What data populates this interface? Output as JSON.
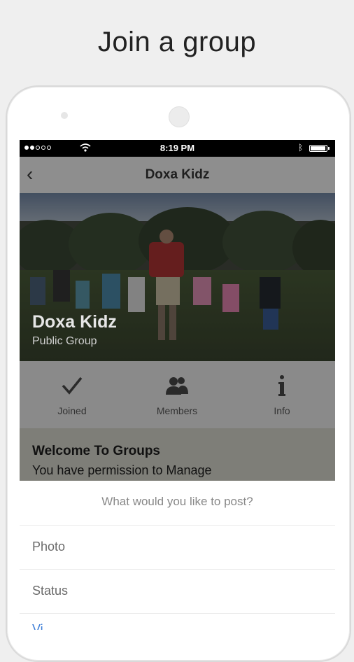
{
  "headline": "Join a group",
  "status_bar": {
    "time": "8:19 PM"
  },
  "nav": {
    "title": "Doxa Kidz"
  },
  "group": {
    "name": "Doxa Kidz",
    "type": "Public Group"
  },
  "actions": [
    {
      "label": "Joined",
      "icon": "check-icon"
    },
    {
      "label": "Members",
      "icon": "members-icon"
    },
    {
      "label": "Info",
      "icon": "info-icon"
    }
  ],
  "welcome": {
    "title": "Welcome To Groups",
    "text": "You have permission to Manage"
  },
  "post_sheet": {
    "title": "What would you like to post?",
    "options": [
      "Photo",
      "Status",
      "Vi"
    ]
  }
}
